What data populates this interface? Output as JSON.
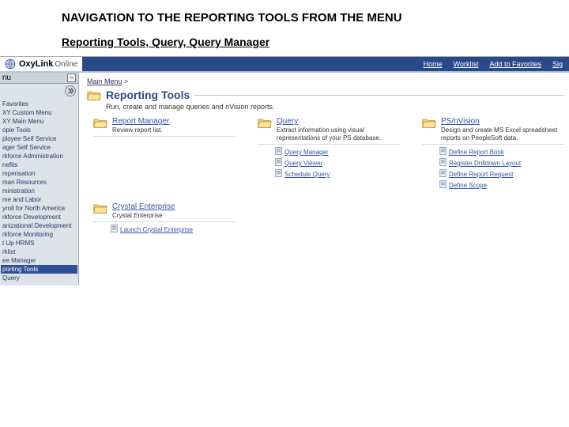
{
  "doc": {
    "title": "NAVIGATION TO THE REPORTING TOOLS FROM THE MENU",
    "breadcrumb": "Reporting Tools, Query, Query Manager"
  },
  "brand": {
    "name": "OxyLink",
    "suffix": "Online"
  },
  "topnav": {
    "home": "Home",
    "worklist": "Worklist",
    "addfav": "Add to Favorites",
    "sign": "Sig"
  },
  "sidebar": {
    "header": "nu",
    "items": [
      "Favorites",
      "XY Custom Menu",
      "XY Main Menu",
      "ople Tools",
      "ployee Self Service",
      "ager Self Service",
      "rkforce Administration",
      "nefits",
      "mpensation",
      "man Resources",
      "ministration",
      "me and Labor",
      "yroll for North America",
      "rkforce Development",
      "anizational Development",
      "rkforce Monitoring",
      "t Up HRMS",
      "rklist",
      "ee Manager",
      "porting Tools",
      "Query"
    ],
    "selected_index": 19
  },
  "breadcrumb": {
    "root": "Main Menu",
    "sep": ">"
  },
  "page": {
    "title": "Reporting Tools",
    "desc": "Run, create and manage queries and nVision reports."
  },
  "folders_row1": [
    {
      "name": "Report Manager",
      "desc": "Review report list.",
      "links": []
    },
    {
      "name": "Query",
      "desc": "Extract information using visual representations of your PS database.",
      "links": [
        "Query Manager",
        "Query Viewer",
        "Schedule Query"
      ]
    },
    {
      "name": "PS/nVision",
      "desc": "Design and create MS Excel spreadsheet reports on PeopleSoft data.",
      "links": [
        "Define Report Book",
        "Register Drilldown Layout",
        "Define Report Request",
        "Define Scope"
      ]
    }
  ],
  "folders_row2": [
    {
      "name": "Crystal Enterprise",
      "desc": "Crystal Enterprise",
      "links": [
        "Launch Crystal Enterprise"
      ]
    }
  ]
}
